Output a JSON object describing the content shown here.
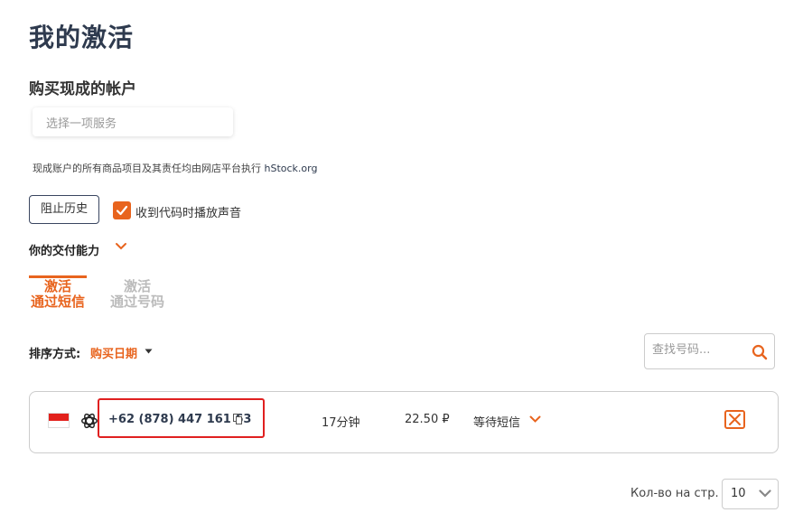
{
  "page": {
    "title": "我的激活"
  },
  "purchase": {
    "section_title": "购买现成的帐户",
    "select_placeholder": "选择一项服务",
    "note_text": "现成账户的所有商品项目及其责任均由网店平台执行 ",
    "note_link": "hStock.org"
  },
  "controls": {
    "history_button": "阻止历史",
    "sound_checkbox_label": "收到代码时播放声音",
    "sound_checkbox_checked": true,
    "ability_label": "你的交付能力"
  },
  "tabs": [
    {
      "line1": "激活",
      "line2": "通过短信",
      "active": true
    },
    {
      "line1": "激活",
      "line2": "通过号码",
      "active": false
    }
  ],
  "sort": {
    "label": "排序方式:",
    "value": "购买日期"
  },
  "search": {
    "placeholder": "查找号码..."
  },
  "activations": [
    {
      "country_flag": "indonesia-flag",
      "service_icon": "openai-icon",
      "phone": "+62 (878) 447 161 63",
      "time_left": "17分钟",
      "price": "22.50 ₽",
      "status": "等待短信"
    }
  ],
  "pagination": {
    "per_page_label": "Кол-во на стр.",
    "per_page_value": "10"
  },
  "colors": {
    "accent": "#e8641e",
    "title": "#2e3a4e",
    "highlight": "#e02020"
  }
}
